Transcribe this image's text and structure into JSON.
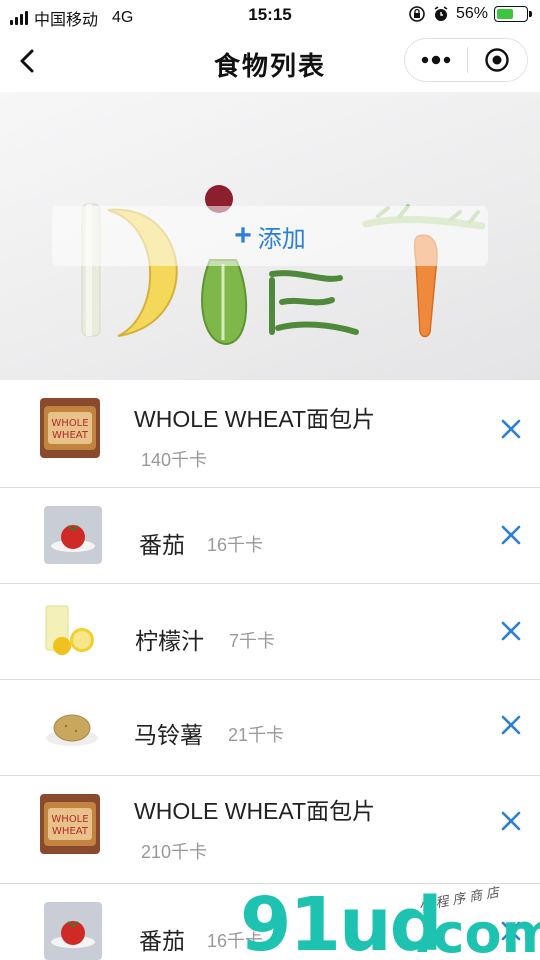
{
  "status_bar": {
    "carrier": "中国移动",
    "network": "4G",
    "time": "15:15",
    "battery_percent": "56%",
    "battery_level": 0.56
  },
  "nav": {
    "title": "食物列表"
  },
  "banner": {
    "add_label": "添加",
    "add_color": "#2b7fd6"
  },
  "foods": [
    {
      "name": "WHOLE WHEAT面包片",
      "calories": "140千卡",
      "thumb": "bread-icon"
    },
    {
      "name": "番茄",
      "calories": "16千卡",
      "thumb": "tomato-icon"
    },
    {
      "name": "柠檬汁",
      "calories": "7千卡",
      "thumb": "lemon-juice-icon"
    },
    {
      "name": "马铃薯",
      "calories": "21千卡",
      "thumb": "potato-icon"
    },
    {
      "name": "WHOLE WHEAT面包片",
      "calories": "210千卡",
      "thumb": "bread-icon"
    },
    {
      "name": "番茄",
      "calories": "16千卡",
      "thumb": "tomato-icon"
    }
  ],
  "watermark": {
    "big": "91ud",
    "small": ".com",
    "tag": "小程序商店"
  }
}
